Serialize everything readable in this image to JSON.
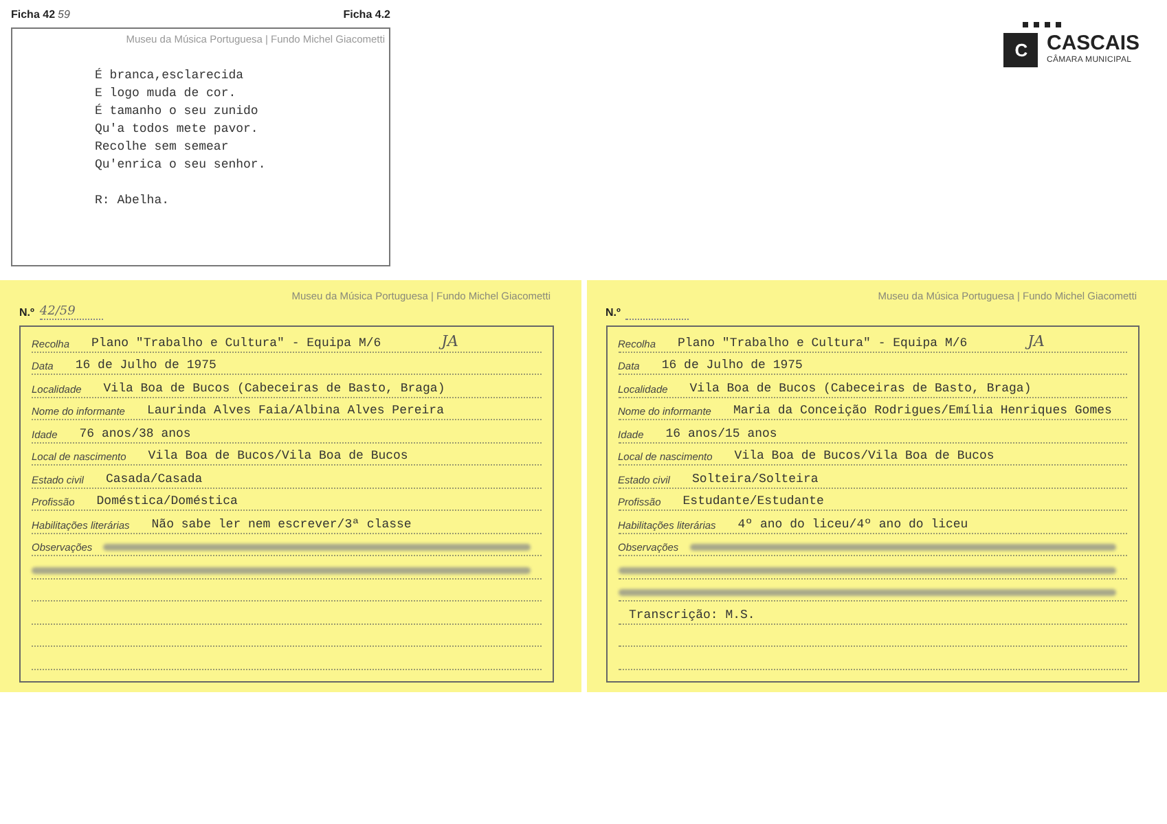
{
  "top_card": {
    "ficha_left": "Ficha 42",
    "ficha_left_handwritten": "59",
    "ficha_right": "Ficha 4.2",
    "museum": "Museu da Música Portuguesa | Fundo Michel Giacometti",
    "verse": [
      "É branca,esclarecida",
      "E logo muda de cor.",
      "É tamanho o seu zunido",
      "Qu'a todos mete pavor.",
      "Recolhe sem semear",
      "Qu'enrica o seu senhor."
    ],
    "answer": "R: Abelha."
  },
  "logo": {
    "name": "CASCAIS",
    "subtitle": "CÂMARA MUNICIPAL",
    "letter": "C"
  },
  "cards": [
    {
      "museum": "Museu da Música Portuguesa | Fundo Michel Giacometti",
      "number_label": "N.º",
      "number": "42/59",
      "initials": "JA",
      "rows": [
        {
          "kind": "field",
          "label": "Recolha",
          "value": "Plano \"Trabalho e Cultura\" - Equipa M/6"
        },
        {
          "kind": "field",
          "label": "Data",
          "value": "16 de Julho de 1975"
        },
        {
          "kind": "field",
          "label": "Localidade",
          "value": "Vila Boa de Bucos (Cabeceiras de Basto, Braga)"
        },
        {
          "kind": "field",
          "label": "Nome do informante",
          "value": "Laurinda Alves Faia/Albina Alves Pereira"
        },
        {
          "kind": "field",
          "label": "Idade",
          "value": "76 anos/38 anos"
        },
        {
          "kind": "field",
          "label": "Local de nascimento",
          "value": "Vila Boa de Bucos/Vila Boa de Bucos"
        },
        {
          "kind": "field",
          "label": "Estado civil",
          "value": "Casada/Casada"
        },
        {
          "kind": "field",
          "label": "Profissão",
          "value": "Doméstica/Doméstica"
        },
        {
          "kind": "field",
          "label": "Habilitações literárias",
          "value": "Não sabe ler nem escrever/3ª classe"
        },
        {
          "kind": "blurred",
          "label": "Observações"
        },
        {
          "kind": "blurred"
        },
        {
          "kind": "blank"
        },
        {
          "kind": "blank"
        },
        {
          "kind": "blank"
        },
        {
          "kind": "blank"
        }
      ]
    },
    {
      "museum": "Museu da Música Portuguesa | Fundo Michel Giacometti",
      "number_label": "N.º",
      "initials": "JA",
      "rows": [
        {
          "kind": "field",
          "label": "Recolha",
          "value": "Plano \"Trabalho e Cultura\" - Equipa M/6"
        },
        {
          "kind": "field",
          "label": "Data",
          "value": "16 de Julho de 1975"
        },
        {
          "kind": "field",
          "label": "Localidade",
          "value": "Vila Boa de Bucos (Cabeceiras de Basto, Braga)"
        },
        {
          "kind": "field",
          "label": "Nome do informante",
          "value": "Maria da Conceição Rodrigues/Emília Henriques Gomes"
        },
        {
          "kind": "field",
          "label": "Idade",
          "value": "16 anos/15 anos"
        },
        {
          "kind": "field",
          "label": "Local de nascimento",
          "value": "Vila Boa de Bucos/Vila Boa de Bucos"
        },
        {
          "kind": "field",
          "label": "Estado civil",
          "value": "Solteira/Solteira"
        },
        {
          "kind": "field",
          "label": "Profissão",
          "value": "Estudante/Estudante"
        },
        {
          "kind": "field",
          "label": "Habilitações literárias",
          "value": "4º ano do liceu/4º ano do liceu"
        },
        {
          "kind": "blurred",
          "label": "Observações"
        },
        {
          "kind": "blurred"
        },
        {
          "kind": "blurred"
        },
        {
          "kind": "field",
          "value": "Transcrição: M.S."
        },
        {
          "kind": "blank"
        },
        {
          "kind": "blank"
        }
      ]
    }
  ]
}
